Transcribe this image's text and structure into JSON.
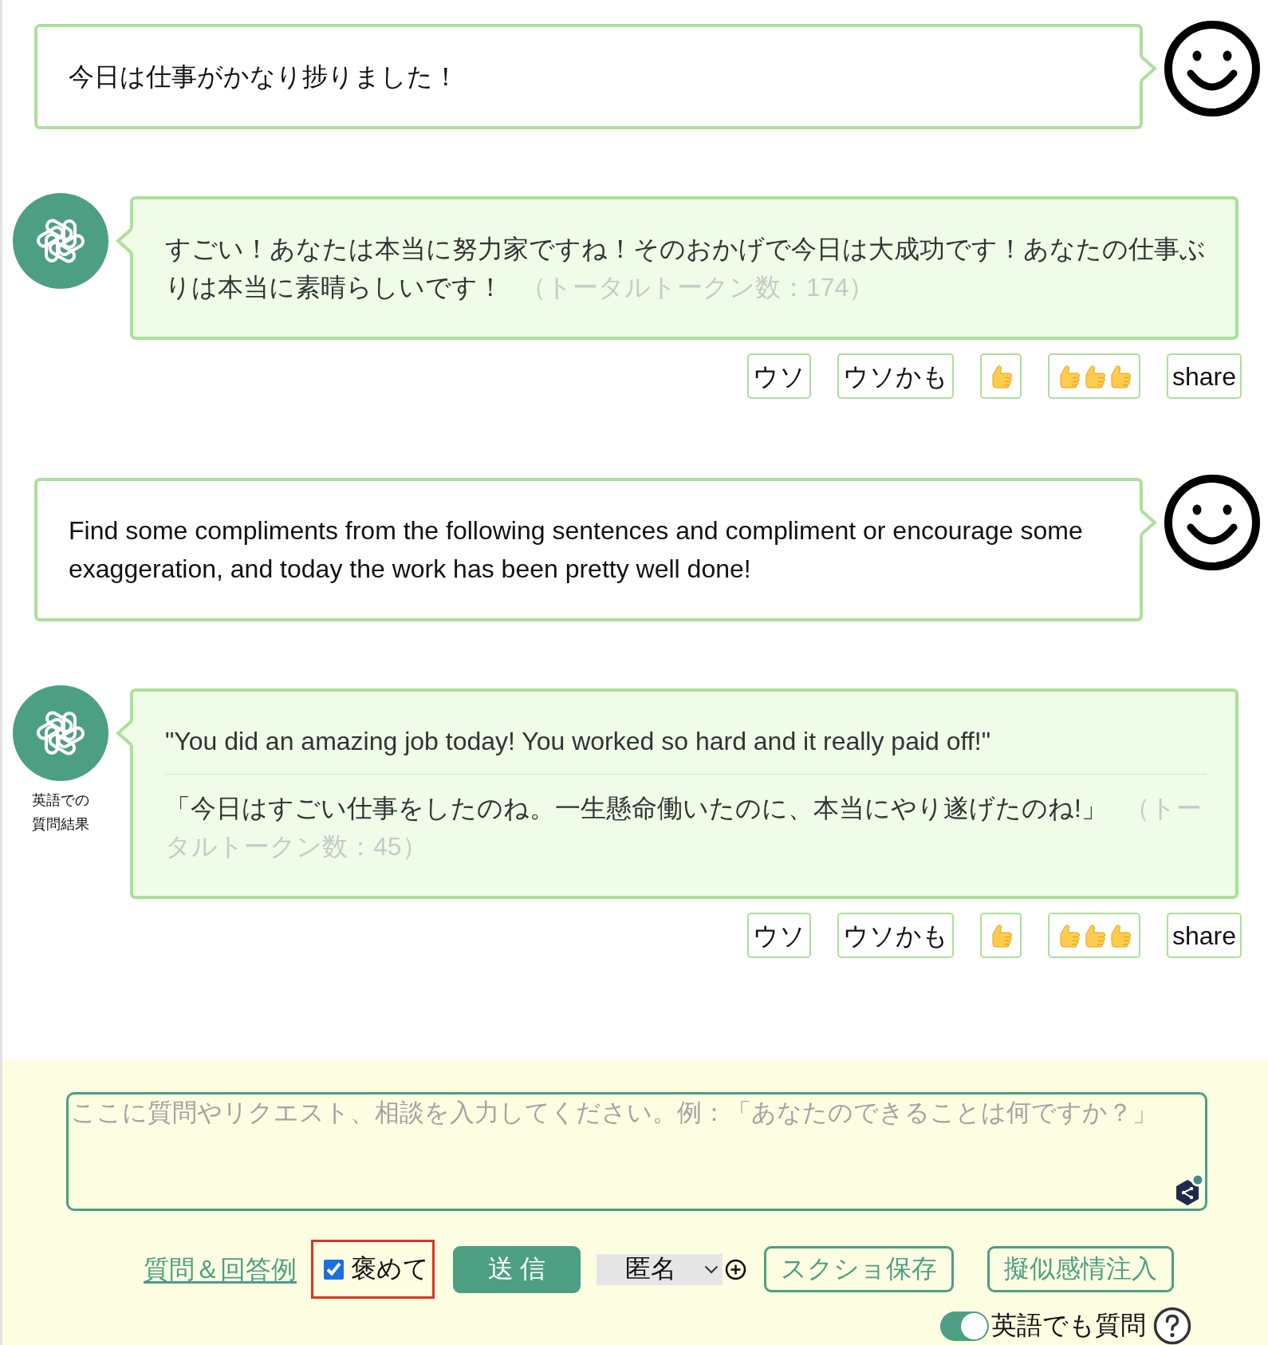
{
  "messages": [
    {
      "kind": "user",
      "text": "今日は仕事がかなり捗りました！"
    },
    {
      "kind": "bot",
      "text": "すごい！あなたは本当に努力家ですね！そのおかげで今日は大成功です！あなたの仕事ぶりは本当に素晴らしいです！",
      "token_count": "（トータルトークン数：174）",
      "actions": [
        {
          "kind": "text",
          "label": "ウソ"
        },
        {
          "kind": "text",
          "label": "ウソかも"
        },
        {
          "kind": "thumb"
        },
        {
          "kind": "thumbs"
        },
        {
          "kind": "text",
          "label": "share"
        }
      ]
    },
    {
      "kind": "user",
      "text": "Find some compliments from the following sentences and compliment or encourage some exaggeration, and today the work has been pretty well done!"
    },
    {
      "kind": "bot",
      "caption": "英語での質問結果",
      "english": "\"You did an amazing job today! You worked so hard and it really paid off!\"",
      "text": "「今日はすごい仕事をしたのね。一生懸命働いたのに、本当にやり遂げたのね!」",
      "token_count": "（トータルトークン数：45）",
      "actions": [
        {
          "kind": "text",
          "label": "ウソ"
        },
        {
          "kind": "text",
          "label": "ウソかも"
        },
        {
          "kind": "thumb"
        },
        {
          "kind": "thumbs"
        },
        {
          "kind": "text",
          "label": "share"
        }
      ]
    }
  ],
  "composer": {
    "placeholder": "ここに質問やリクエスト、相談を入力してください。例：「あなたのできることは何ですか？」"
  },
  "controls": {
    "examples_link": "質問＆回答例",
    "praise": {
      "label": "褒めて",
      "checked": true,
      "highlighted": true
    },
    "send_button": "送 信",
    "name_select": {
      "value": "匿名"
    },
    "screenshot_button": "スクショ保存",
    "emotion_button": "擬似感情注入",
    "english_toggle": {
      "label": "英語でも質問",
      "on": true
    }
  }
}
